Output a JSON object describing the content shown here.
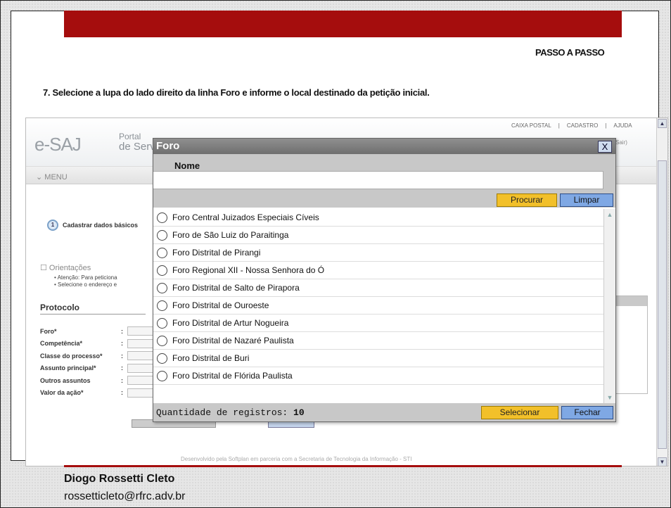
{
  "header": {
    "passo_label": "PASSO A PASSO",
    "instruction": "7. Selecione a lupa do lado direito da linha Foro e informe o local destinado da petição inicial."
  },
  "portal": {
    "logo": "e-SAJ",
    "logo_sub": "Portal",
    "logo_sub2": "de Serv",
    "top_links": [
      "CAIXA POSTAL",
      "|",
      "CADASTRO",
      "|",
      "AJUDA"
    ],
    "sair": "Sair)",
    "menu_label": "MENU",
    "step_number": "1",
    "step_label": "Cadastrar dados básicos",
    "orientacoes": "Orientações",
    "orient_items": [
      "Atenção: Para peticiona",
      "Selecione o endereço e"
    ],
    "protocolo": "Protocolo",
    "fields": [
      "Foro*",
      "Competência*",
      "Classe do processo*",
      "Assunto principal*",
      "Outros assuntos",
      "Valor da ação*"
    ],
    "footer": "Desenvolvido pela Softplan em parceria com a Secretaria de Tecnologia da Informação - STI"
  },
  "modal": {
    "title": "Foro",
    "close": "X",
    "column_header": "Nome",
    "search_value": "",
    "procurar": "Procurar",
    "limpar": "Limpar",
    "items": [
      "Foro Central Juizados Especiais Cíveis",
      "Foro de São Luiz do Paraitinga",
      "Foro Distrital de Pirangi",
      "Foro Regional XII - Nossa Senhora do Ó",
      "Foro Distrital de Salto de Pirapora",
      "Foro Distrital de Ouroeste",
      "Foro Distrital de Artur Nogueira",
      "Foro Distrital de Nazaré Paulista",
      "Foro Distrital de Buri",
      "Foro Distrital de Flórida Paulista"
    ],
    "quantidade_label": "Quantidade de registros:",
    "quantidade_value": "10",
    "selecionar": "Selecionar",
    "fechar": "Fechar"
  },
  "author": {
    "name": "Diogo Rossetti Cleto",
    "email": "rossetticleto@rfrc.adv.br"
  },
  "colors": {
    "brand_red": "#a50d0d",
    "button_yellow": "#f2c02a",
    "button_blue": "#7fa8e4"
  }
}
